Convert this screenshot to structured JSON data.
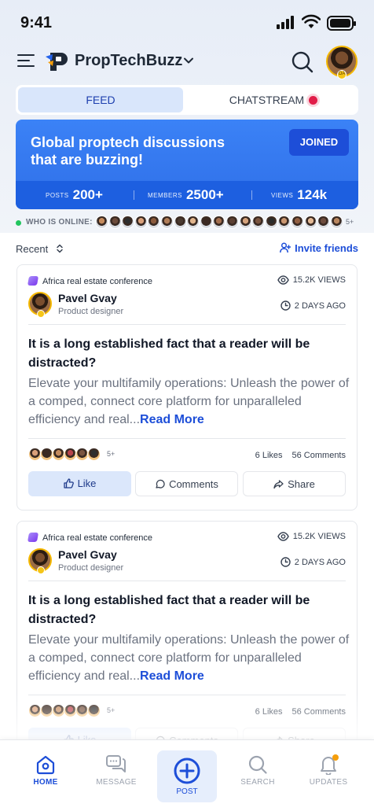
{
  "status": {
    "time": "9:41"
  },
  "header": {
    "brand": "PropTechBuzz",
    "avatar_badge": "OA"
  },
  "tabs": [
    {
      "label": "FEED",
      "active": true
    },
    {
      "label": "CHATSTREAM",
      "active": false
    }
  ],
  "banner": {
    "title": "Global proptech discussions that are buzzing!",
    "join_label": "JOINED",
    "stats": [
      {
        "label": "POSTS",
        "value": "200+"
      },
      {
        "label": "MEMBERS",
        "value": "2500+"
      },
      {
        "label": "VIEWS",
        "value": "124k"
      }
    ]
  },
  "online": {
    "label": "WHO IS ONLINE:",
    "more": "5+"
  },
  "feed": {
    "sort_label": "Recent",
    "invite_label": "Invite friends"
  },
  "posts": [
    {
      "community": "Africa real estate conference",
      "views": "15.2K VIEWS",
      "author": "Pavel Gvay",
      "role": "Product designer",
      "time": "2 DAYS AGO",
      "title": "It is a long established fact that a reader will be distracted?",
      "body": "Elevate your multifamily operations: Unleash the power of a comped, connect core platform for unparalleled efficiency and real...",
      "read_more": "Read More",
      "likers_more": "5+",
      "likes": "6 Likes",
      "comments": "56 Comments",
      "like_label": "Like",
      "comments_label": "Comments",
      "share_label": "Share"
    },
    {
      "community": "Africa real estate conference",
      "views": "15.2K VIEWS",
      "author": "Pavel Gvay",
      "role": "Product designer",
      "time": "2 DAYS AGO",
      "title": "It is a long established fact that a reader will be distracted?",
      "body": "Elevate your multifamily operations: Unleash the power of a comped, connect core platform for unparalleled efficiency and real...",
      "read_more": "Read More",
      "likers_more": "5+",
      "likes": "6 Likes",
      "comments": "56 Comments",
      "like_label": "Like",
      "comments_label": "Comments",
      "share_label": "Share"
    }
  ],
  "nav": [
    {
      "label": "HOME",
      "icon": "home-icon",
      "active": true
    },
    {
      "label": "MESSAGE",
      "icon": "message-icon",
      "active": false
    },
    {
      "label": "POST",
      "icon": "plus-circle-icon",
      "active": false
    },
    {
      "label": "SEARCH",
      "icon": "search-icon",
      "active": false
    },
    {
      "label": "UPDATES",
      "icon": "bell-icon",
      "active": false
    }
  ],
  "colors": {
    "accent": "#1d4ed8",
    "banner": "#3b82f6",
    "online": "#22c55e",
    "notification": "#e11d48"
  }
}
